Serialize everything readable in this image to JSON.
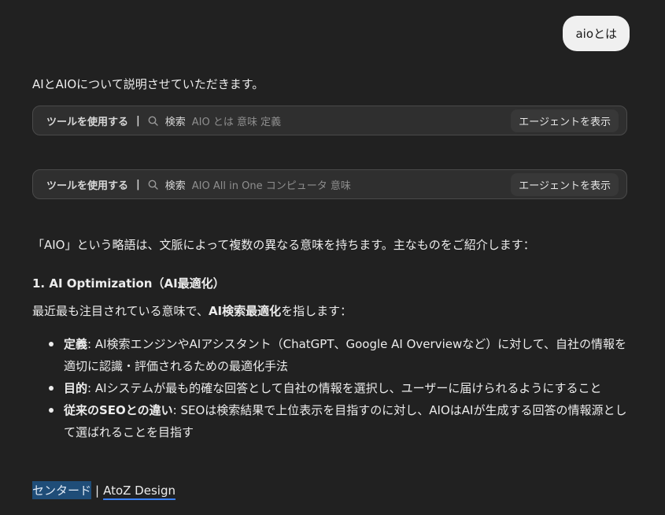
{
  "user_message": "aioとは",
  "intro": "AIとAIOについて説明させていただきます。",
  "tool_calls": [
    {
      "label": "ツールを使用する",
      "separator": "|",
      "search_word": "検索",
      "query": "AIO とは 意味 定義",
      "agent_button": "エージェントを表示"
    },
    {
      "label": "ツールを使用する",
      "separator": "|",
      "search_word": "検索",
      "query": "AIO All in One コンピュータ 意味",
      "agent_button": "エージェントを表示"
    }
  ],
  "paragraph1": "「AIO」という略語は、文脈によって複数の異なる意味を持ちます。主なものをご紹介します：",
  "heading1": "1. AI Optimization（AI最適化）",
  "paragraph2": {
    "before": "最近最も注目されている意味で、",
    "bold": "AI検索最適化",
    "after": "を指します："
  },
  "bullets": [
    {
      "term": "定義",
      "text": ": AI検索エンジンやAIアシスタント（ChatGPT、Google AI Overviewなど）に対して、自社の情報を適切に認識・評価されるための最適化手法"
    },
    {
      "term": "目的",
      "text": ": AIシステムが最も的確な回答として自社の情報を選択し、ユーザーに届けられるようにすること"
    },
    {
      "term": "従来のSEOとの違い",
      "text": ": SEOは検索結果で上位表示を目指すのに対し、AIOはAIが生成する回答の情報源として選ばれることを目指す"
    }
  ],
  "footer": {
    "highlighted": "センタード",
    "separator": "|",
    "link": "AtoZ Design"
  },
  "colors": {
    "background": "#212121",
    "user_bubble": "#f0f0f0",
    "highlight": "#1f4d78",
    "link_underline": "#3b82f6"
  },
  "icons": [
    "search-icon"
  ]
}
